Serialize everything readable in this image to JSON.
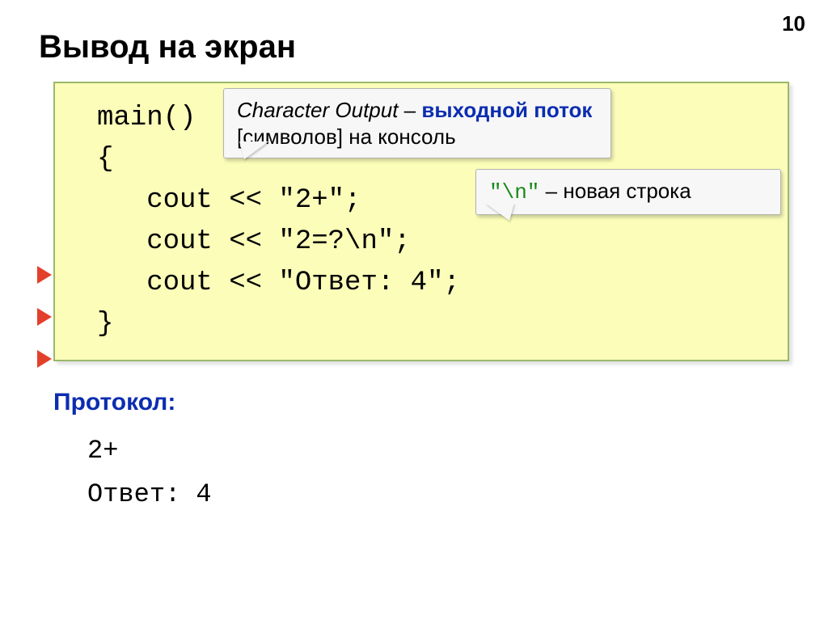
{
  "page_number": "10",
  "title": "Вывод на экран",
  "code": {
    "line1": "main()",
    "line2": "{",
    "line3": "   cout << \"2+\";",
    "line4": "   cout << \"2=?\\n\";",
    "line5": "   cout << \"Ответ: 4\";",
    "line6": "}"
  },
  "callout1": {
    "part1": "Character Output",
    "part2": " – ",
    "part3": "выходной поток",
    "part4": " [символов] на консоль"
  },
  "callout2": {
    "part1": "\"\\n\"",
    "part2": " – новая строка"
  },
  "protocol_label": "Протокол:",
  "protocol": {
    "line1": "2+",
    "line2": "Ответ: 4"
  }
}
